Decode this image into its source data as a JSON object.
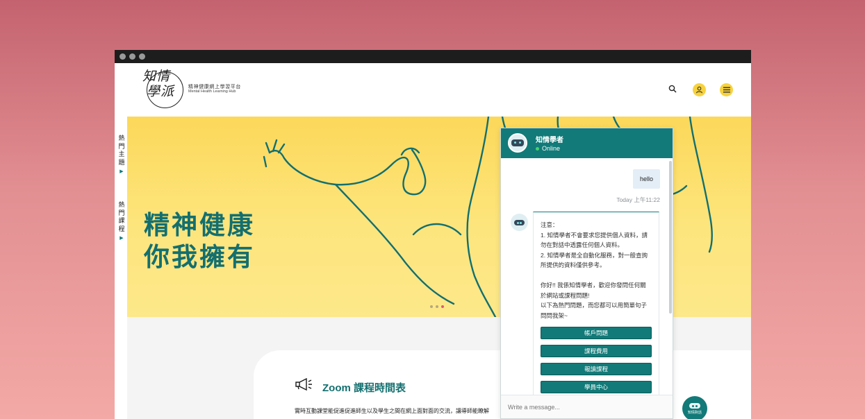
{
  "header": {
    "logo_mark_line1": "知情",
    "logo_mark_line2": "學派",
    "logo_title": "精神健康網上學習平台",
    "logo_subtitle": "Mental Health Learning Hub",
    "search_icon": "search-icon",
    "user_icon": "user-icon",
    "menu_icon": "menu-icon"
  },
  "side_tabs": [
    {
      "label": "熱門主題"
    },
    {
      "label": "熱門課程"
    }
  ],
  "banner": {
    "title_line1": "精神健康",
    "title_line2": "你我擁有",
    "slide_count": 3,
    "active_slide": 3
  },
  "zoom": {
    "title": "Zoom 課程時間表",
    "description": "實時互動課堂能促進促進師生以及學生之間在網上面對面的交流，讓導師能瞭解"
  },
  "chat": {
    "bot_name": "知情學者",
    "status": "Online",
    "user_message": "hello",
    "time": "Today 上午11:22",
    "bot_message": "注意：\n1. 知情學者不會要求您提供個人資料，請勿在對話中透露任何個人資料。\n2. 知情學者是全自動化服務，對一般查詢所提供的資料僅供參考。\n\n你好!! 我係知情學者，歡迎你發問任何關於網站或課程問題!\n以下為熱門問題，而您都可以用簡單句子問問我架~",
    "quick_replies": [
      "帳戶問題",
      "課程費用",
      "報讀課程",
      "學員中心"
    ],
    "input_placeholder": "Write a message...",
    "fab_label": "知情對話"
  },
  "colors": {
    "brand_teal": "#127a78",
    "banner_yellow": "#fcd85a",
    "accent_yellow": "#f7d23e"
  }
}
